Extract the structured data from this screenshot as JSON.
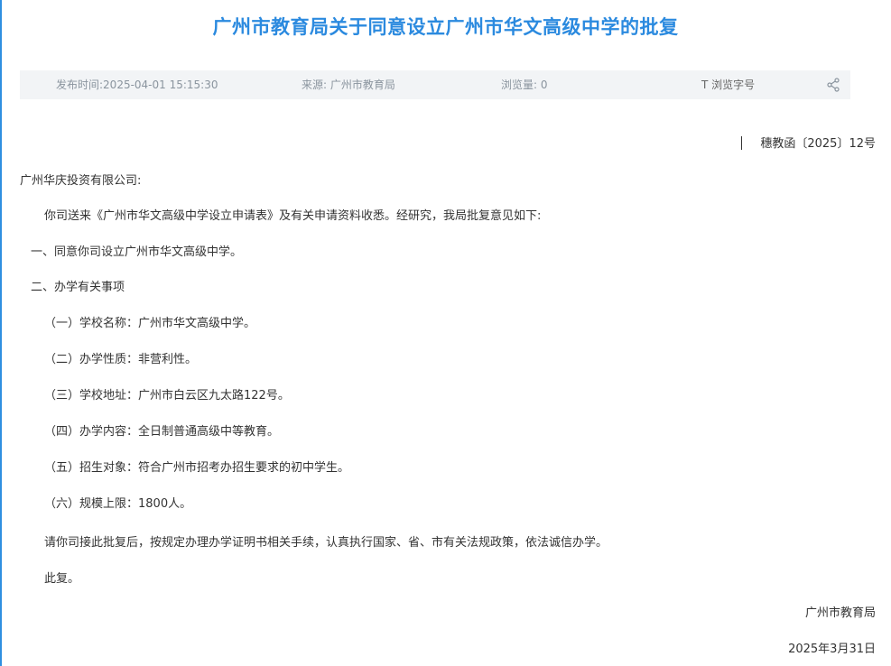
{
  "title": "广州市教育局关于同意设立广州市华文高级中学的批复",
  "meta": {
    "publish_time": "发布时间:2025-04-01 15:15:30",
    "source": "来源: 广州市教育局",
    "views": "浏览量: 0",
    "font_size_label": "T 浏览字号",
    "share_icon": "share-icon"
  },
  "doc_number": "穗教函〔2025〕12号",
  "body": {
    "addressee": "广州华庆投资有限公司:",
    "intro": "你司送来《广州市华文高级中学设立申请表》及有关申请资料收悉。经研究，我局批复意见如下:",
    "item1": "一、同意你司设立广州市华文高级中学。",
    "item2": "二、办学有关事项",
    "sub1": "（一）学校名称：广州市华文高级中学。",
    "sub2": "（二）办学性质：非营利性。",
    "sub3": "（三）学校地址：广州市白云区九太路122号。",
    "sub4": "（四）办学内容：全日制普通高级中等教育。",
    "sub5": "（五）招生对象：符合广州市招考办招生要求的初中学生。",
    "sub6": "（六）规模上限：1800人。",
    "closing": "请你司接此批复后，按规定办理办学证明书相关手续，认真执行国家、省、市有关法规政策，依法诚信办学。",
    "reply": "此复。"
  },
  "signature": {
    "org": "广州市教育局",
    "date": "2025年3月31日"
  }
}
